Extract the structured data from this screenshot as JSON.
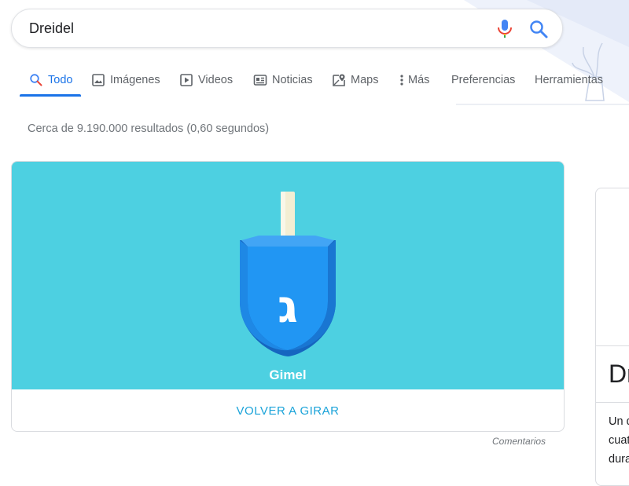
{
  "search": {
    "query": "Dreidel"
  },
  "tabs": [
    {
      "label": "Todo",
      "icon": "search-icon"
    },
    {
      "label": "Imágenes",
      "icon": "image-icon"
    },
    {
      "label": "Videos",
      "icon": "play-icon"
    },
    {
      "label": "Noticias",
      "icon": "news-icon"
    },
    {
      "label": "Maps",
      "icon": "map-pin-icon"
    },
    {
      "label": "Más",
      "icon": "more-vert-icon"
    }
  ],
  "tools": {
    "preferences": "Preferencias",
    "tools": "Herramientas"
  },
  "results": {
    "stats": "Cerca de 9.190.000 resultados (0,60 segundos)"
  },
  "dreidel_widget": {
    "letter_glyph": "ג",
    "letter_name": "Gimel",
    "spin_again": "VOLVER A GIRAR",
    "feedback": "Comentarios",
    "colors": {
      "background": "#4dd0e1",
      "body": "#2196f3",
      "body_dark": "#1976d2",
      "handle": "#f5f1dc",
      "link": "#1aa3d9"
    }
  },
  "knowledge_panel": {
    "title_partial": "Dr",
    "desc_lines": [
      "Un d",
      "cuat",
      "dura"
    ]
  },
  "colors": {
    "accent": "#1a73e8",
    "muted": "#5f6368"
  }
}
